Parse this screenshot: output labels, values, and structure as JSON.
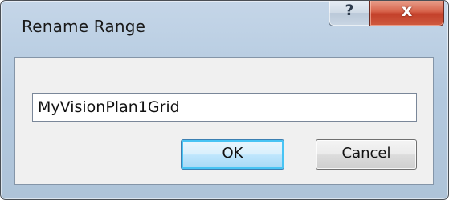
{
  "window": {
    "title": "Rename Range",
    "help_glyph": "?",
    "close_glyph": "x"
  },
  "form": {
    "name_value": "MyVisionPlan1Grid"
  },
  "buttons": {
    "ok_label": "OK",
    "cancel_label": "Cancel"
  },
  "icons": {
    "help": "help-icon",
    "close": "close-icon"
  },
  "colors": {
    "close_button": "#c9452f",
    "default_button_glow": "#48c4f4",
    "frame": "#b8cce0"
  }
}
